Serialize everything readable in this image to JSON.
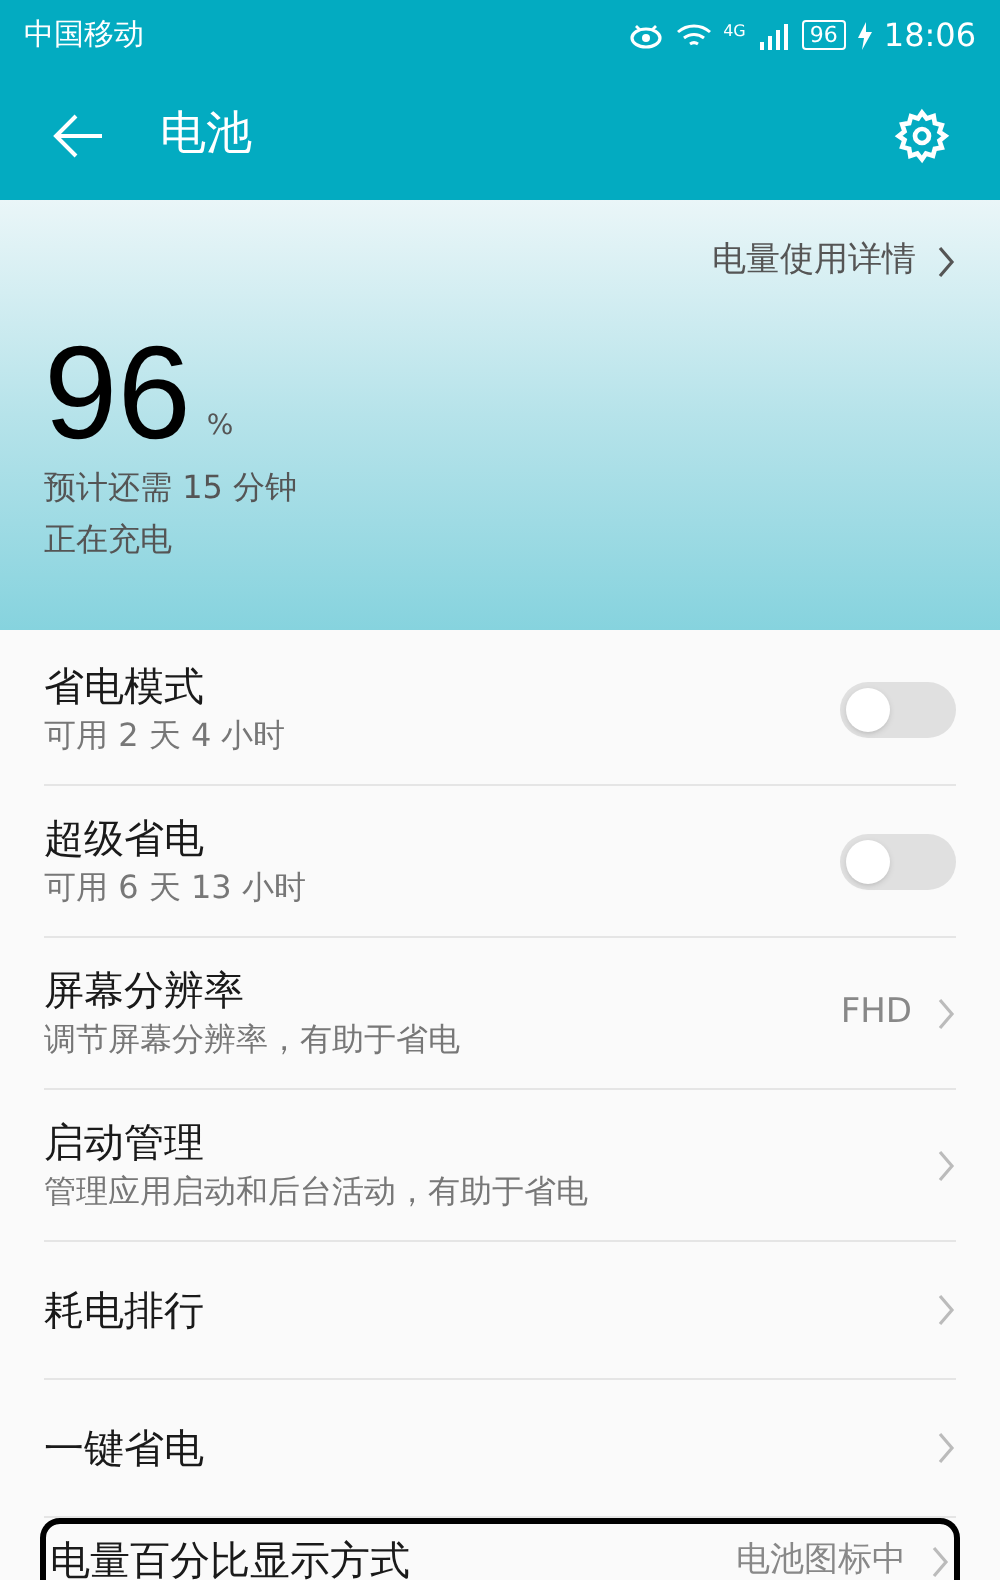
{
  "status_bar": {
    "carrier": "中国移动",
    "network": "4G",
    "battery": "96",
    "time": "18:06"
  },
  "header": {
    "title": "电池"
  },
  "summary": {
    "details_link": "电量使用详情",
    "percent": "96",
    "unit": "%",
    "estimate": "预计还需 15 分钟",
    "state": "正在充电"
  },
  "settings": [
    {
      "kind": "toggle",
      "title": "省电模式",
      "subtitle": "可用 2 天 4 小时",
      "on": false
    },
    {
      "kind": "toggle",
      "title": "超级省电",
      "subtitle": "可用 6 天 13 小时",
      "on": false
    },
    {
      "kind": "link",
      "title": "屏幕分辨率",
      "subtitle": "调节屏幕分辨率，有助于省电",
      "value": "FHD"
    },
    {
      "kind": "link",
      "title": "启动管理",
      "subtitle": "管理应用启动和后台活动，有助于省电"
    },
    {
      "kind": "link",
      "title": "耗电排行"
    },
    {
      "kind": "link",
      "title": "一键省电"
    },
    {
      "kind": "link",
      "title": "电量百分比显示方式",
      "value": "电池图标中",
      "highlighted": true
    }
  ]
}
